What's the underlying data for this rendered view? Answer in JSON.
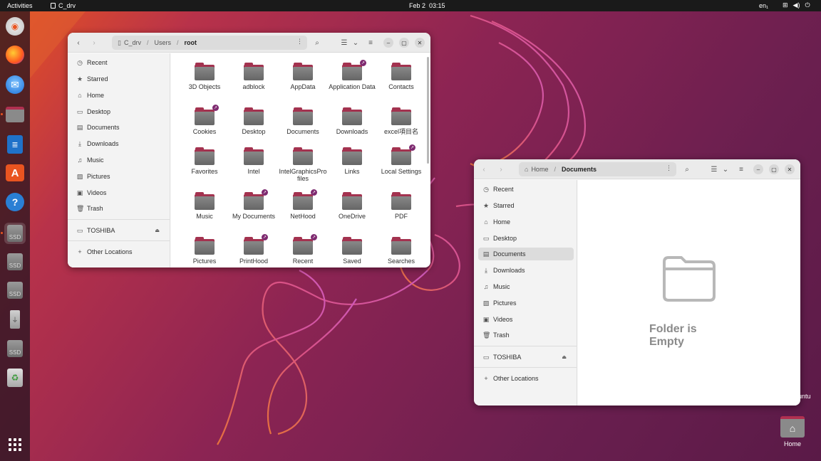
{
  "topbar": {
    "activities": "Activities",
    "app_name": "C_drv",
    "date": "Feb 2",
    "time": "03:15",
    "language": "en₁"
  },
  "dock": {
    "items": [
      "ubuntu-installer",
      "firefox",
      "thunderbird",
      "files",
      "libreoffice-writer",
      "app-center",
      "help",
      "ssd",
      "ssd",
      "ssd",
      "usb",
      "ssd",
      "trash",
      "show-apps"
    ],
    "ssd_label": "SSD"
  },
  "window1": {
    "path": {
      "root": "C_drv",
      "mid": "Users",
      "current": "root"
    },
    "sidebar": {
      "items": [
        {
          "label": "Recent"
        },
        {
          "label": "Starred"
        },
        {
          "label": "Home"
        },
        {
          "label": "Desktop"
        },
        {
          "label": "Documents"
        },
        {
          "label": "Downloads"
        },
        {
          "label": "Music"
        },
        {
          "label": "Pictures"
        },
        {
          "label": "Videos"
        },
        {
          "label": "Trash"
        }
      ],
      "device": "TOSHIBA",
      "other": "Other Locations"
    },
    "folders": [
      {
        "name": "3D Objects",
        "link": false
      },
      {
        "name": "adblock",
        "link": false
      },
      {
        "name": "AppData",
        "link": false
      },
      {
        "name": "Application Data",
        "link": true
      },
      {
        "name": "Contacts",
        "link": false
      },
      {
        "name": "Cookies",
        "link": true
      },
      {
        "name": "Desktop",
        "link": false
      },
      {
        "name": "Documents",
        "link": false
      },
      {
        "name": "Downloads",
        "link": false
      },
      {
        "name": "excel項目名",
        "link": false
      },
      {
        "name": "Favorites",
        "link": false
      },
      {
        "name": "Intel",
        "link": false
      },
      {
        "name": "IntelGraphicsProfiles",
        "link": false
      },
      {
        "name": "Links",
        "link": false
      },
      {
        "name": "Local Settings",
        "link": true
      },
      {
        "name": "Music",
        "link": false
      },
      {
        "name": "My Documents",
        "link": true
      },
      {
        "name": "NetHood",
        "link": true
      },
      {
        "name": "OneDrive",
        "link": false
      },
      {
        "name": "PDF",
        "link": false
      },
      {
        "name": "Pictures",
        "link": false
      },
      {
        "name": "PrintHood",
        "link": true
      },
      {
        "name": "Recent",
        "link": true
      },
      {
        "name": "Saved",
        "link": false
      },
      {
        "name": "Searches",
        "link": false
      }
    ]
  },
  "window2": {
    "path": {
      "home": "Home",
      "current": "Documents"
    },
    "sidebar": {
      "items": [
        {
          "label": "Recent"
        },
        {
          "label": "Starred"
        },
        {
          "label": "Home"
        },
        {
          "label": "Desktop"
        },
        {
          "label": "Documents"
        },
        {
          "label": "Downloads"
        },
        {
          "label": "Music"
        },
        {
          "label": "Pictures"
        },
        {
          "label": "Videos"
        },
        {
          "label": "Trash"
        }
      ],
      "selected": "Documents",
      "device": "TOSHIBA",
      "other": "Other Locations"
    },
    "empty_message": "Folder is Empty"
  },
  "desktop": {
    "home_label": "Home",
    "partial_label": "untu"
  }
}
